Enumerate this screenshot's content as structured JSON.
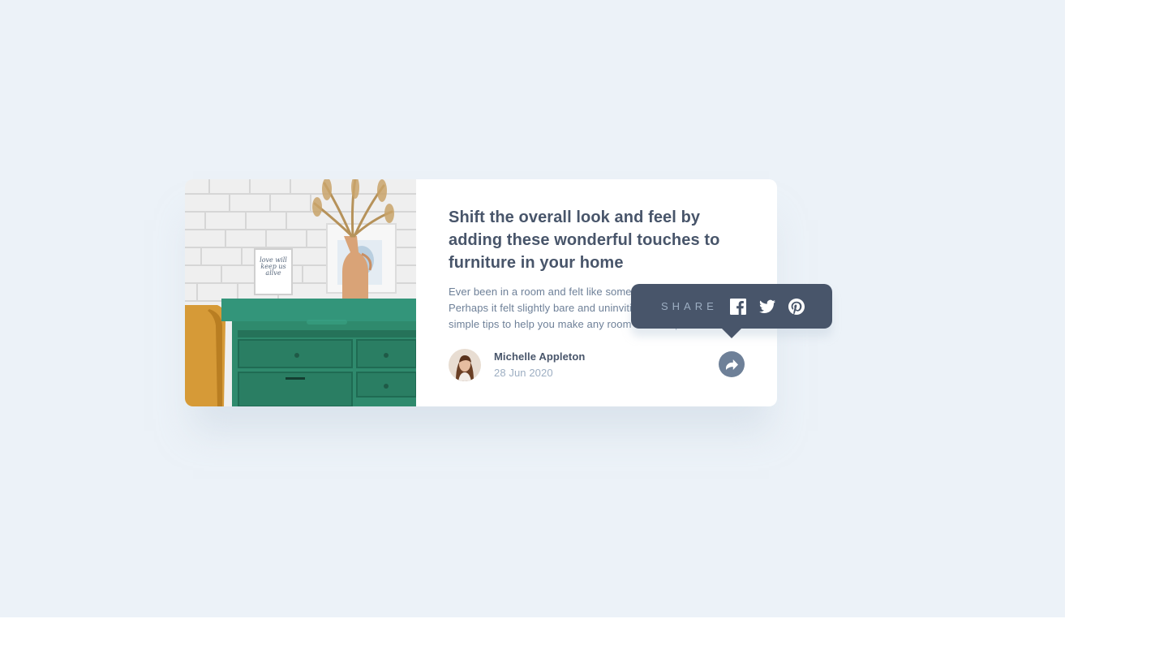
{
  "article": {
    "title": "Shift the overall look and feel by adding these wonderful touches to furniture in your home",
    "excerpt": "Ever been in a room and felt like something was missing? Perhaps it felt slightly bare and uninviting. I’ve got some simple tips to help you make any room feel complete.",
    "image_alt": "drawers",
    "frame_text": "love will keep us alive"
  },
  "author": {
    "name": "Michelle Appleton",
    "date": "28 Jun 2020"
  },
  "share": {
    "label": "SHARE",
    "icons": [
      "facebook-icon",
      "twitter-icon",
      "pinterest-icon"
    ],
    "button_icon": "share-arrow-icon"
  },
  "colors": {
    "background": "#ecf2f8",
    "dark_text": "#48556a",
    "body_text": "#6e8098",
    "light_text": "#9daec2",
    "popup_bg": "#48556a",
    "drawer_green": "#2f8a6d"
  }
}
